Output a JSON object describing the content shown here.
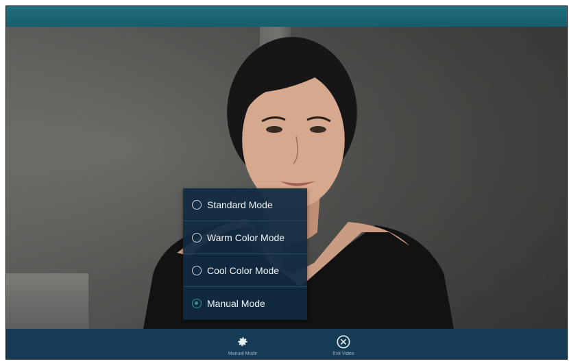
{
  "menu": {
    "options": [
      {
        "label": "Standard Mode",
        "selected": false
      },
      {
        "label": "Warm Color Mode",
        "selected": false
      },
      {
        "label": "Cool Color Mode",
        "selected": false
      },
      {
        "label": "Manual Mode",
        "selected": true
      }
    ]
  },
  "toolbar": {
    "manual_mode": {
      "label": "Manual Mode",
      "icon": "gear-icon"
    },
    "exit_video": {
      "label": "Exit Video",
      "icon": "close-circle-icon"
    }
  },
  "colors": {
    "top_bar": "#1f6d7d",
    "toolbar": "#163b57",
    "menu_bg": "#112b42",
    "selected_radio": "#3a8f8c"
  }
}
